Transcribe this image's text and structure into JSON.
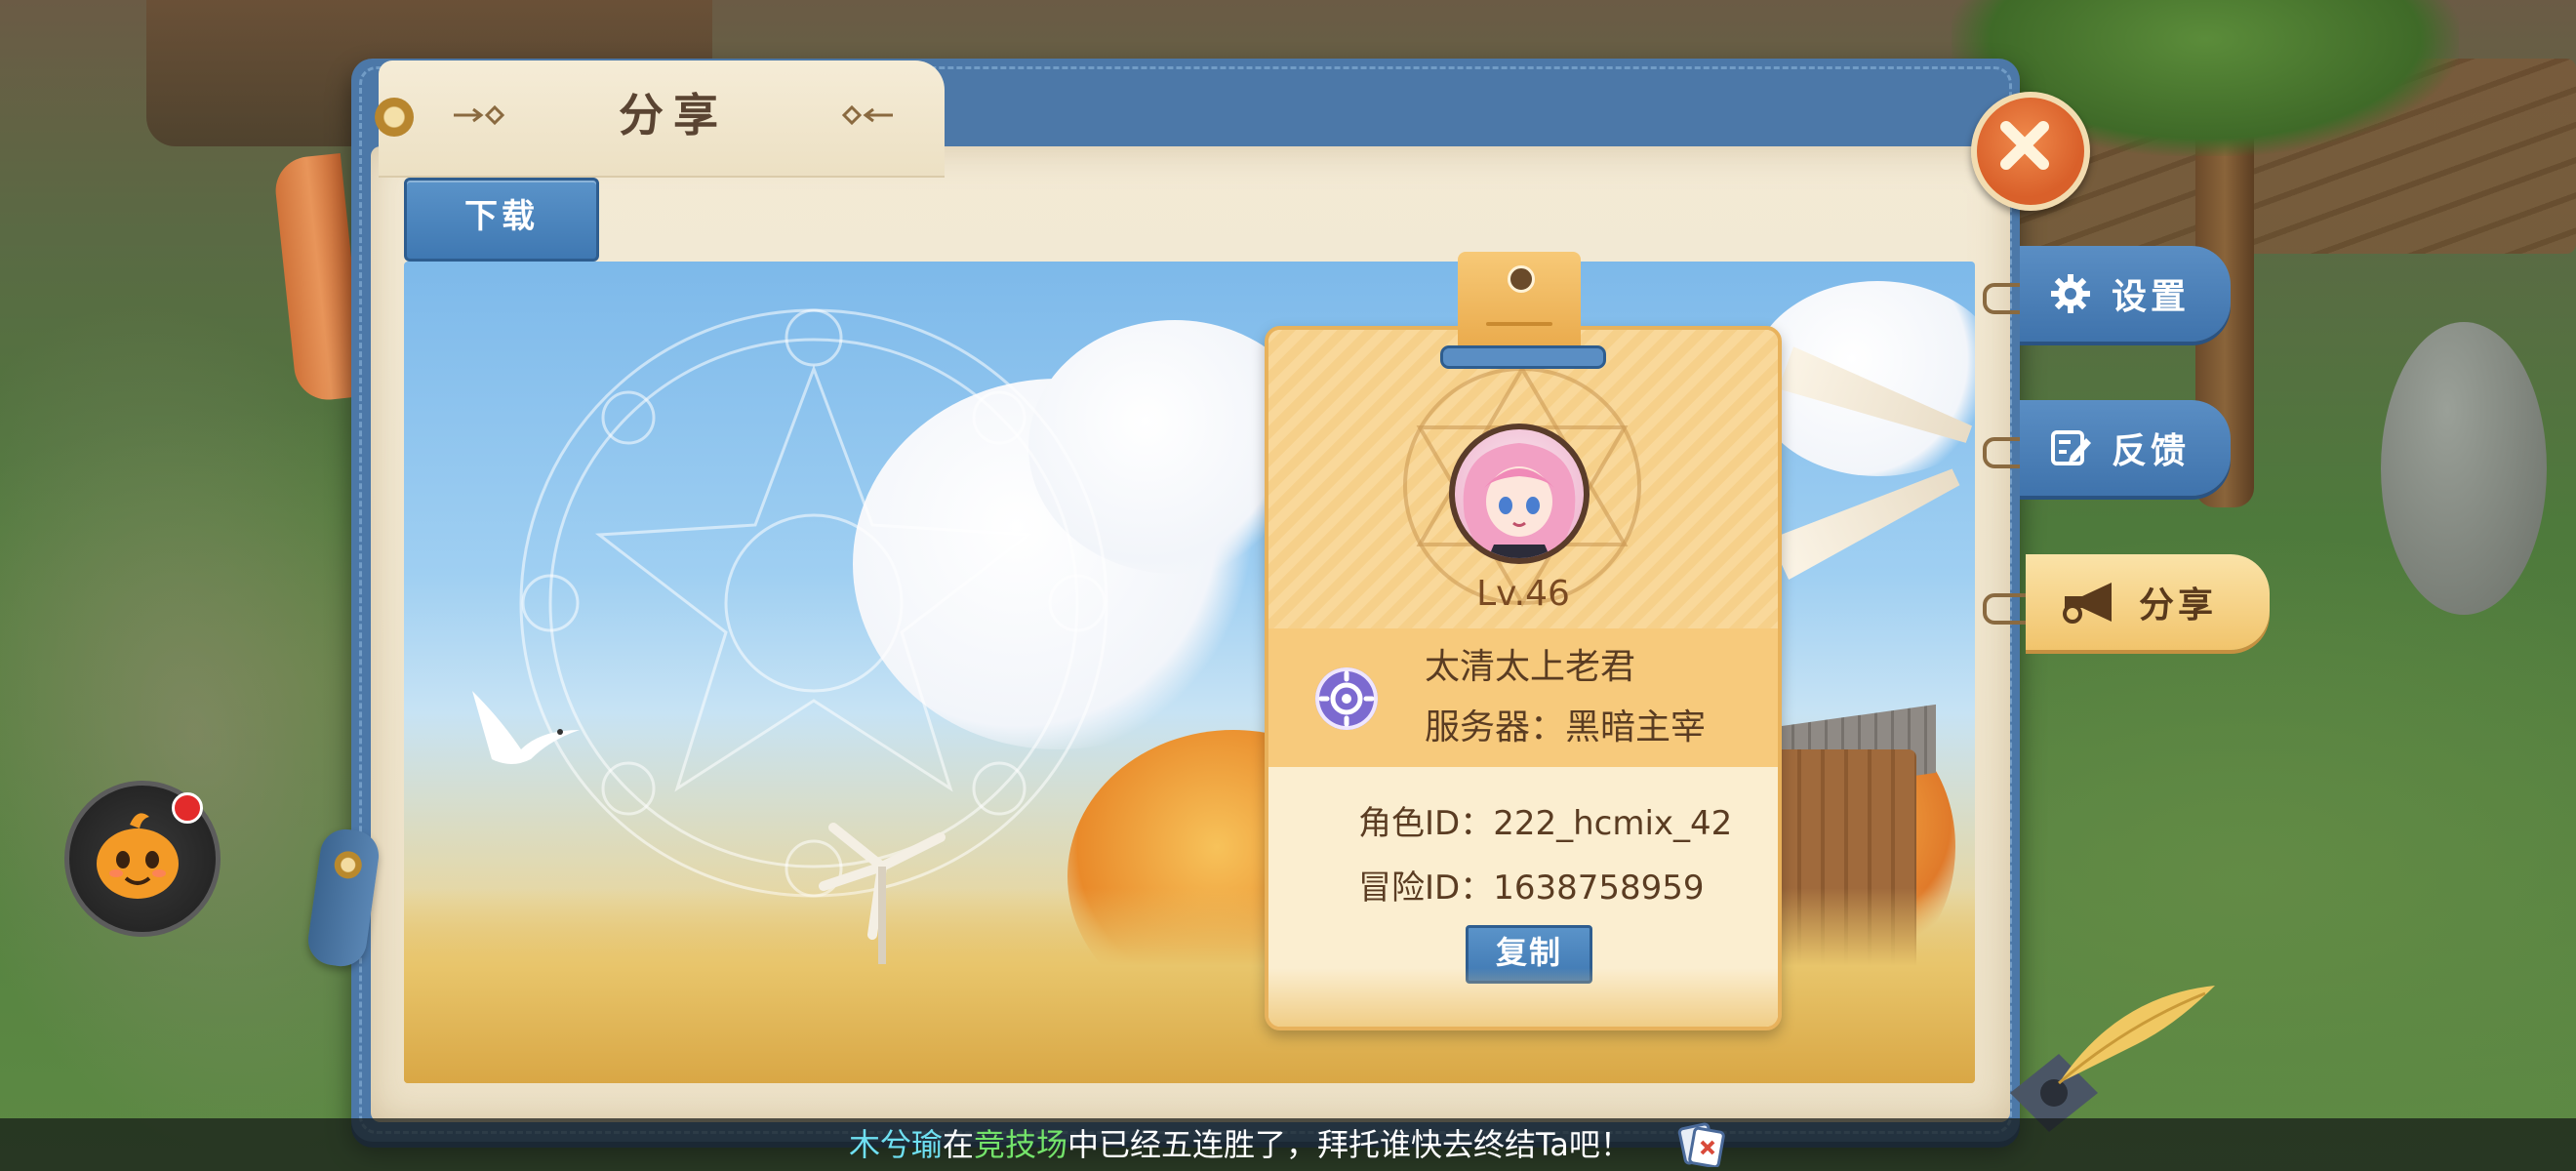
{
  "panel": {
    "tab_title": "分享",
    "download_label": "下载"
  },
  "card": {
    "level": "Lv.46",
    "name": "太清太上老君",
    "server": "服务器：黑暗主宰",
    "role_id": "角色ID：222_hcmix_42",
    "adventure_id": "冒险ID：1638758959",
    "copy_label": "复制"
  },
  "side_tabs": [
    {
      "label": "设置",
      "icon": "gear-icon"
    },
    {
      "label": "反馈",
      "icon": "edit-icon"
    },
    {
      "label": "分享",
      "icon": "horn-icon",
      "active": true
    }
  ],
  "marquee": {
    "player": "木兮瑜",
    "t1": "在",
    "arena": "竞技场",
    "t2": "中已经五连胜了，拜托谁快去终结Ta吧！"
  },
  "colors": {
    "accent_blue": "#3f78b2",
    "card_gold": "#f7ca7c",
    "close_orange": "#d9602a",
    "marquee_player": "#6fe0f2",
    "marquee_arena": "#74e36a"
  }
}
